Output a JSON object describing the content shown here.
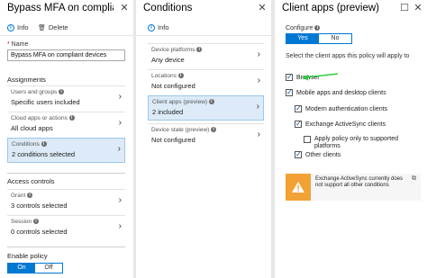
{
  "blade1": {
    "title": "Bypass MFA on compliant de...",
    "toolbar": {
      "info": "Info",
      "delete": "Delete"
    },
    "name_label": "Name",
    "name_value": "Bypass MFA on compliant devices",
    "assignments_heading": "Assignments",
    "assignments": [
      {
        "label": "Users and groups",
        "value": "Specific users included"
      },
      {
        "label": "Cloud apps or actions",
        "value": "All cloud apps"
      },
      {
        "label": "Conditions",
        "value": "2 conditions selected"
      }
    ],
    "access_controls_heading": "Access controls",
    "access_controls": [
      {
        "label": "Grant",
        "value": "3 controls selected"
      },
      {
        "label": "Session",
        "value": "0 controls selected"
      }
    ],
    "enable_policy_label": "Enable policy",
    "enable_policy_on": "On",
    "enable_policy_off": "Off"
  },
  "blade2": {
    "title": "Conditions",
    "toolbar": {
      "info": "Info"
    },
    "items": [
      {
        "label": "Device platforms",
        "value": "Any device"
      },
      {
        "label": "Locations",
        "value": "Not configured"
      },
      {
        "label": "Client apps (preview)",
        "value": "2 included"
      },
      {
        "label": "Device state (preview)",
        "value": "Not configured"
      }
    ]
  },
  "blade3": {
    "title": "Client apps (preview)",
    "configure_label": "Configure",
    "configure_yes": "Yes",
    "configure_no": "No",
    "select_text": "Select the client apps this policy will apply to",
    "options": {
      "browser": "Browser",
      "mobile": "Mobile apps and desktop clients",
      "modern": "Modern authentication clients",
      "eas": "Exchange ActiveSync clients",
      "apply": "Apply policy only to supported platforms",
      "other": "Other clients"
    },
    "warning_text": "Exchange ActiveSync currently does not support all other conditions"
  },
  "colors": {
    "accent": "#0078d4",
    "selected_bg": "#dcebf7",
    "warning": "#f2a135",
    "annotation_arrow": "#2ecc40"
  }
}
